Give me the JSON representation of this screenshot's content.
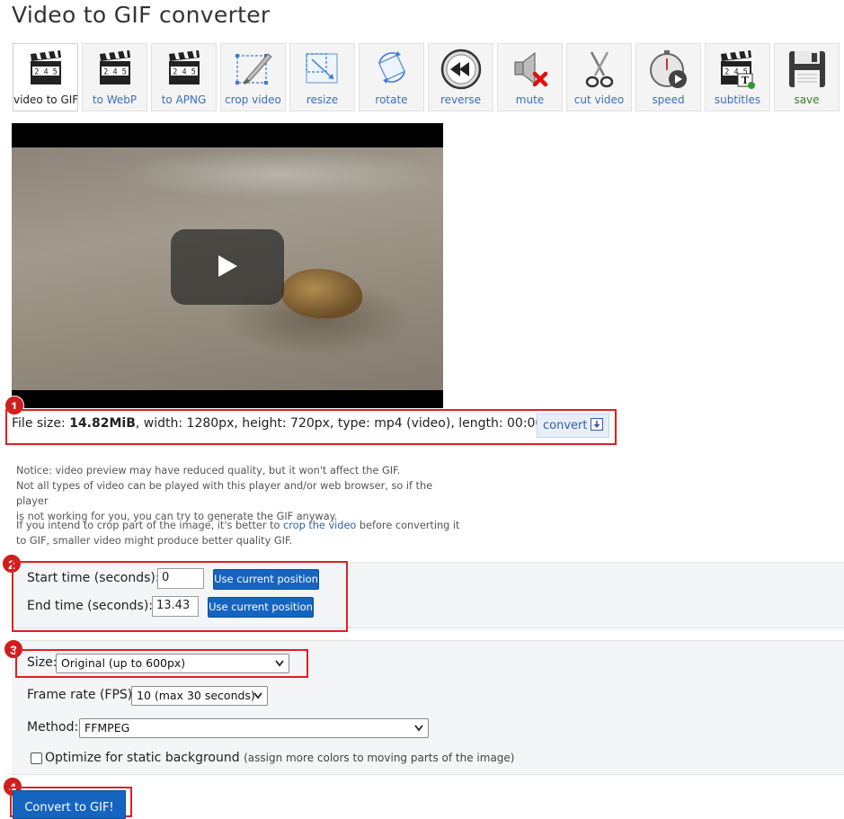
{
  "page": {
    "title": "Video to GIF converter"
  },
  "toolbar": {
    "items": [
      {
        "label": "video to GIF",
        "icon": "clapperboard-icon",
        "active": true
      },
      {
        "label": "to WebP",
        "icon": "clapperboard-icon"
      },
      {
        "label": "to APNG",
        "icon": "clapperboard-icon"
      },
      {
        "label": "crop video",
        "icon": "crop-icon"
      },
      {
        "label": "resize",
        "icon": "resize-icon"
      },
      {
        "label": "rotate",
        "icon": "rotate-icon"
      },
      {
        "label": "reverse",
        "icon": "rewind-icon"
      },
      {
        "label": "mute",
        "icon": "mute-speaker-icon"
      },
      {
        "label": "cut video",
        "icon": "scissors-icon"
      },
      {
        "label": "speed",
        "icon": "stopwatch-icon"
      },
      {
        "label": "subtitles",
        "icon": "subtitles-clapperboard-icon"
      },
      {
        "label": "save",
        "icon": "floppy-disk-icon"
      }
    ],
    "clapper_digits": "2 4 5"
  },
  "markers": [
    "1",
    "2",
    "3",
    "4"
  ],
  "file_info": {
    "prefix": "File size: ",
    "size": "14.82MiB",
    "rest": ", width: 1280px, height: 720px, type: mp4 (video), length: 00:00:13",
    "convert_label": "convert"
  },
  "notice": {
    "line1": "Notice: video preview may have reduced quality, but it won't affect the GIF.",
    "line2": "Not all types of video can be played with this player and/or web browser, so if the player",
    "line3": "is not working for you, you can try to generate the GIF anyway.",
    "crop_pre": "If you intend to crop part of the image, it's better to ",
    "crop_link": "crop the video",
    "crop_post": " before converting it",
    "crop_line2": "to GIF, smaller video might produce better quality GIF."
  },
  "time": {
    "start_label": "Start time (seconds):",
    "start_value": "0",
    "end_label": "End time (seconds):",
    "end_value": "13.43",
    "use_current": "Use current position"
  },
  "options": {
    "size_label": "Size:",
    "size_value": "Original (up to 600px)",
    "fps_label": "Frame rate (FPS):",
    "fps_value": "10 (max 30 seconds)",
    "method_label": "Method:",
    "method_value": "FFMPEG",
    "optimize_label": "Optimize for static background",
    "optimize_note": "(assign more colors to moving parts of the image)",
    "optimize_checked": false
  },
  "submit": {
    "label": "Convert to GIF!"
  },
  "colors": {
    "accent": "#1565c0",
    "marker": "#d01d1d",
    "link": "#2f5fa5"
  }
}
